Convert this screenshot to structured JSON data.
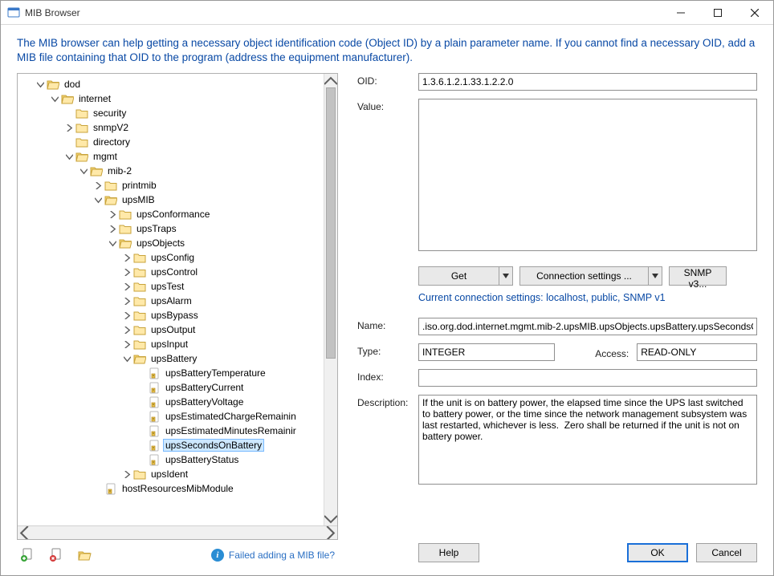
{
  "window": {
    "title": "MIB Browser"
  },
  "intro": "The MIB browser can help getting a necessary object identification code (Object ID) by a plain parameter name. If you cannot find a necessary OID, add a MIB file containing that OID to the program (address the equipment manufacturer).",
  "labels": {
    "oid": "OID:",
    "value": "Value:",
    "name": "Name:",
    "type": "Type:",
    "access": "Access:",
    "index": "Index:",
    "description": "Description:"
  },
  "fields": {
    "oid": "1.3.6.1.2.1.33.1.2.2.0",
    "value": "",
    "name": ".iso.org.dod.internet.mgmt.mib-2.upsMIB.upsObjects.upsBattery.upsSecondsO",
    "type": "INTEGER",
    "access": "READ-ONLY",
    "index": "",
    "description": "If the unit is on battery power, the elapsed time since the UPS last switched to battery power, or the time since the network management subsystem was last restarted, whichever is less.  Zero shall be returned if the unit is not on battery power."
  },
  "buttons": {
    "get": "Get",
    "conn": "Connection settings ...",
    "snmp": "SNMP v3...",
    "help": "Help",
    "ok": "OK",
    "cancel": "Cancel"
  },
  "conn_note": "Current connection settings: localhost, public, SNMP v1",
  "faq": "Failed adding a MIB file?",
  "tree": {
    "dod": "dod",
    "internet": "internet",
    "security": "security",
    "snmpV2": "snmpV2",
    "directory": "directory",
    "mgmt": "mgmt",
    "mib2": "mib-2",
    "printmib": "printmib",
    "upsMIB": "upsMIB",
    "upsConformance": "upsConformance",
    "upsTraps": "upsTraps",
    "upsObjects": "upsObjects",
    "upsConfig": "upsConfig",
    "upsControl": "upsControl",
    "upsTest": "upsTest",
    "upsAlarm": "upsAlarm",
    "upsBypass": "upsBypass",
    "upsOutput": "upsOutput",
    "upsInput": "upsInput",
    "upsBattery": "upsBattery",
    "upsBatteryTemperature": "upsBatteryTemperature",
    "upsBatteryCurrent": "upsBatteryCurrent",
    "upsBatteryVoltage": "upsBatteryVoltage",
    "upsEstimatedChargeRemaining": "upsEstimatedChargeRemainin",
    "upsEstimatedMinutesRemaining": "upsEstimatedMinutesRemainir",
    "upsSecondsOnBattery": "upsSecondsOnBattery",
    "upsBatteryStatus": "upsBatteryStatus",
    "upsIdent": "upsIdent",
    "hostResourcesMibModule": "hostResourcesMibModule"
  }
}
